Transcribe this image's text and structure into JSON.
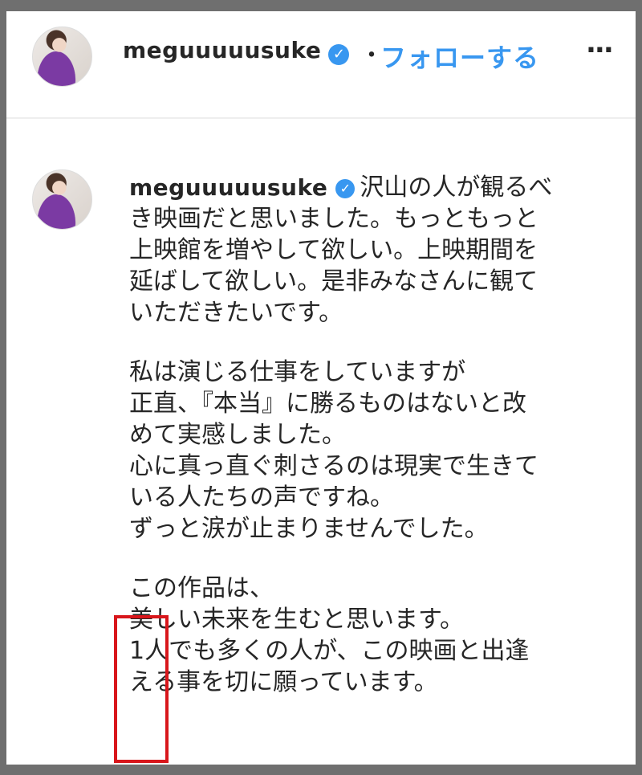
{
  "header": {
    "username": "meguuuuusuke",
    "verified_icon": "verified-badge-icon",
    "separator": "・",
    "follow_label": "フォローする",
    "more_label": "..."
  },
  "comment": {
    "username": "meguuuuusuke",
    "paragraph1_lead": "沢山の人が観るべ",
    "paragraph1_lines": [
      "き映画だと思いました。もっともっと",
      "上映館を増やして欲しい。上映期間を",
      "延ばして欲しい。是非みなさんに観て",
      "いただきたいです。"
    ],
    "paragraph2_lines": [
      "私は演じる仕事をしていますが",
      "正直、『本当』に勝るものはないと改",
      "めて実感しました。",
      "心に真っ直ぐ刺さるのは現実で生きて",
      "いる人たちの声ですね。",
      "ずっと涙が止まりませんでした。"
    ],
    "paragraph3_lines": [
      "この作品は、",
      "美しい未来を生むと思います。",
      "1人でも多くの人が、この映画と出逢",
      "える事を切に願っています。"
    ]
  },
  "colors": {
    "follow_blue": "#3897f0",
    "highlight_red": "#d8161b",
    "text": "#262626"
  }
}
